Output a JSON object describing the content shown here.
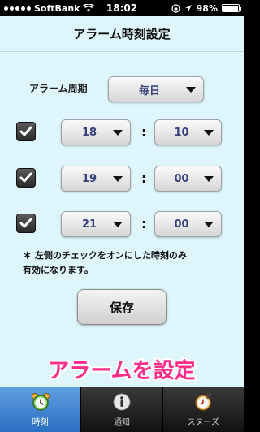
{
  "status_bar": {
    "carrier": "SoftBank",
    "time": "18:02",
    "battery": "98%",
    "battery_level": 0.98
  },
  "nav": {
    "title": "アラーム時刻設定"
  },
  "period": {
    "label": "アラーム周期",
    "value": "毎日"
  },
  "alarms": [
    {
      "checked": true,
      "hour": "18",
      "minute": "10"
    },
    {
      "checked": true,
      "hour": "19",
      "minute": "00"
    },
    {
      "checked": true,
      "hour": "21",
      "minute": "00"
    }
  ],
  "separator": ":",
  "note": {
    "line1": "＊ 左側のチェックをオンにした時刻のみ",
    "line2": "有効になります。"
  },
  "save_label": "保存",
  "caption": "アラームを設定",
  "tabs": [
    {
      "label": "時刻",
      "icon": "alarm-clock-icon",
      "active": true
    },
    {
      "label": "通知",
      "icon": "info-icon",
      "active": false
    },
    {
      "label": "スヌーズ",
      "icon": "snooze-clock-icon",
      "active": false
    }
  ],
  "colors": {
    "background": "#def5fb",
    "dropdown_text": "#37417a",
    "caption": "#ff2d8a",
    "tab_active": "#2b6fc2"
  }
}
